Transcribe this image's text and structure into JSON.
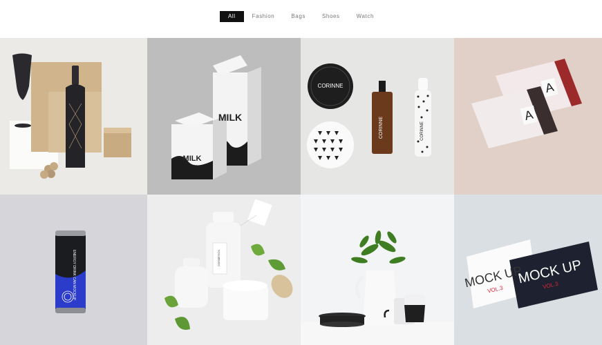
{
  "filters": {
    "tabs": [
      {
        "label": "All",
        "active": true
      },
      {
        "label": "Fashion",
        "active": false
      },
      {
        "label": "Bags",
        "active": false
      },
      {
        "label": "Shoes",
        "active": false
      },
      {
        "label": "Watch",
        "active": false
      }
    ]
  },
  "tiles": {
    "milk": {
      "label_front": "MILK",
      "label_back": "MILK"
    },
    "cosmetics": {
      "brand": "CORINNE",
      "bottle_label": "CORINNE",
      "spray_label": "CORINNE"
    },
    "wipes": {
      "letter": "A"
    },
    "can": {
      "label": "ENERGY DRINK CAN MOCKUP"
    },
    "cream": {
      "label": "COSMETICS"
    },
    "cards": {
      "title": "MOCK UP",
      "vol": "VOL.3"
    }
  },
  "colors": {
    "active_tab_bg": "#111111",
    "active_tab_text": "#ffffff",
    "tab_text": "#777777"
  }
}
